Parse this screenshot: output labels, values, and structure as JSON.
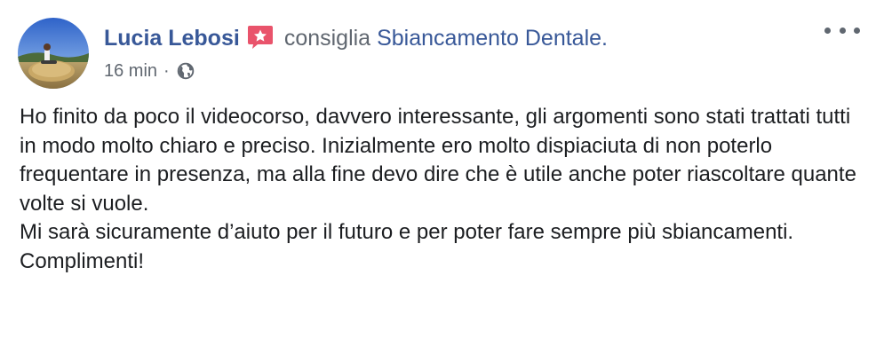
{
  "post": {
    "author_name": "Lucia Lebosi",
    "recommendation_verb": "consiglia",
    "page_name": "Sbiancamento Dentale",
    "period": ".",
    "timestamp": "16 min",
    "separator": "·",
    "privacy_icon": "globe-icon",
    "recommend_icon": "recommendation-star-icon",
    "more_icon": "ellipsis-icon",
    "body_lines": [
      "Ho finito da poco il videocorso, davvero interessante, gli argomenti sono stati trattati tutti in modo molto chiaro e preciso. Inizialmente ero molto dispiaciuta di non poterlo frequentare in presenza, ma alla fine devo dire che è utile anche poter riascoltare quante volte si vuole.",
      "Mi sarà sicuramente d’aiuto per il futuro e per poter fare sempre più sbiancamenti.",
      "Complimenti!"
    ]
  },
  "colors": {
    "link": "#385898",
    "secondary_text": "#606770",
    "body_text": "#1c1e21",
    "recommend_badge": "#e9536b"
  }
}
